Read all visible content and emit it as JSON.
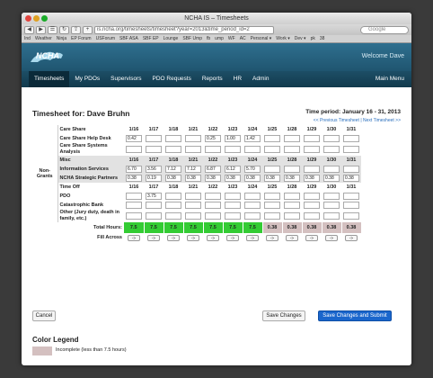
{
  "window": {
    "title": "NCHA IS – Timesheets"
  },
  "browser": {
    "url": "is.ncha.org/timesheets/timesheet?year=2013&time_period_id=2",
    "search_placeholder": "Google",
    "bookmarks": [
      "Ind",
      "Weather",
      "Ninja",
      "EP Forum",
      "USForum",
      "SBF ASA",
      "SBF EP",
      "Lounge",
      "SBF Ump",
      "fb",
      "ump",
      "WF",
      "AC",
      "Personal ▾",
      "Work ▾",
      "Dev ▾",
      "pk",
      "38"
    ]
  },
  "site": {
    "logo_text": "NCHA",
    "welcome": "Welcome Dave",
    "nav": [
      "Timesheets",
      "My PDOs",
      "Supervisors",
      "PDO Requests",
      "Reports",
      "HR",
      "Admin"
    ],
    "main_menu": "Main Menu"
  },
  "timesheet": {
    "title": "Timesheet for: Dave Bruhn",
    "period": "Time period: January 16 - 31, 2013",
    "prev_link": "<< Previous Timesheet",
    "separator": "|",
    "next_link": "Next Timesheet >>",
    "dates": [
      "1/16",
      "1/17",
      "1/18",
      "1/21",
      "1/22",
      "1/23",
      "1/24",
      "1/25",
      "1/28",
      "1/29",
      "1/30",
      "1/31"
    ],
    "group_label": "Non-Grants",
    "sections": [
      {
        "header": "Care Share",
        "rows": [
          {
            "label": "Care Share Help Desk",
            "values": [
              "0.42",
              "",
              "",
              "",
              "0.25",
              "1.00",
              "1.42",
              "",
              "",
              "",
              "",
              ""
            ]
          },
          {
            "label": "Care Share Systems Analysis",
            "values": [
              "",
              "",
              "",
              "",
              "",
              "",
              "",
              "",
              "",
              "",
              "",
              ""
            ]
          }
        ]
      },
      {
        "header": "Misc",
        "rows": [
          {
            "label": "Information Services",
            "values": [
              "6.70",
              "3.56",
              "7.12",
              "7.12",
              "6.87",
              "6.12",
              "5.70",
              "",
              "",
              "",
              "",
              ""
            ]
          },
          {
            "label": "NCHA Strategic Partners",
            "values": [
              "0.38",
              "0.19",
              "0.38",
              "0.38",
              "0.38",
              "0.38",
              "0.38",
              "0.38",
              "0.38",
              "0.38",
              "0.38",
              "0.38"
            ]
          }
        ]
      },
      {
        "header": "Time Off",
        "rows": [
          {
            "label": "PDO",
            "values": [
              "",
              "3.75",
              "",
              "",
              "",
              "",
              "",
              "",
              "",
              "",
              "",
              ""
            ]
          },
          {
            "label": "Catastrophic Bank",
            "values": [
              "",
              "",
              "",
              "",
              "",
              "",
              "",
              "",
              "",
              "",
              "",
              ""
            ]
          },
          {
            "label": "Other (Jury duty, death in family, etc.)",
            "values": [
              "",
              "",
              "",
              "",
              "",
              "",
              "",
              "",
              "",
              "",
              "",
              ""
            ]
          }
        ]
      }
    ],
    "total_label": "Total Hours:",
    "totals": [
      "7.5",
      "7.5",
      "7.5",
      "7.5",
      "7.5",
      "7.5",
      "7.5",
      "0.38",
      "0.38",
      "0.38",
      "0.38",
      "0.38"
    ],
    "fill_label": "Fill Across",
    "fill_button": "->"
  },
  "buttons": {
    "cancel": "Cancel",
    "save": "Save Changes",
    "submit": "Save Changes and Submit"
  },
  "legend": {
    "title": "Color Legend",
    "incomplete": "Incomplete (less than 7.5 hours)"
  },
  "colors": {
    "complete": "#33cc33",
    "incomplete": "#d4c0c0",
    "nav": "#1d4e66",
    "header": "#2f6f8f",
    "submit": "#1a66cc"
  }
}
